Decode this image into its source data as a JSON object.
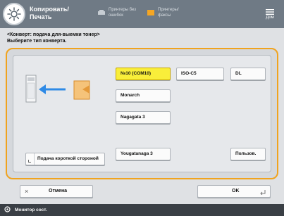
{
  "header": {
    "title_line1": "Копировать/",
    "title_line2": "Печать",
    "status1": [
      "Принтеры без",
      "ошибок"
    ],
    "status2": [
      "Принтеры/",
      "факсы"
    ],
    "home_label": "Дом"
  },
  "instruction": {
    "line1": "<Конверт: подача для-выемки тонер>",
    "line2": "Выберите тип конверта."
  },
  "options": {
    "opt1": "№10 (COM10)",
    "opt2": "ISO-C5",
    "opt3": "DL",
    "opt4": "Monarch",
    "opt5": "Nagagata 3",
    "opt6": "Yougatanaga 3",
    "opt7": "Пользов."
  },
  "feed_button": "Подача короткой стороной",
  "bottom": {
    "cancel": "Отмена",
    "ok": "OK"
  },
  "statusbar": {
    "label": "Монитор сост."
  },
  "colors": {
    "accent_orange": "#f0a31e",
    "selected_yellow": "#f9ee3a",
    "arrow_blue": "#2e8ae6",
    "envelope_orange": "#f5a623"
  }
}
